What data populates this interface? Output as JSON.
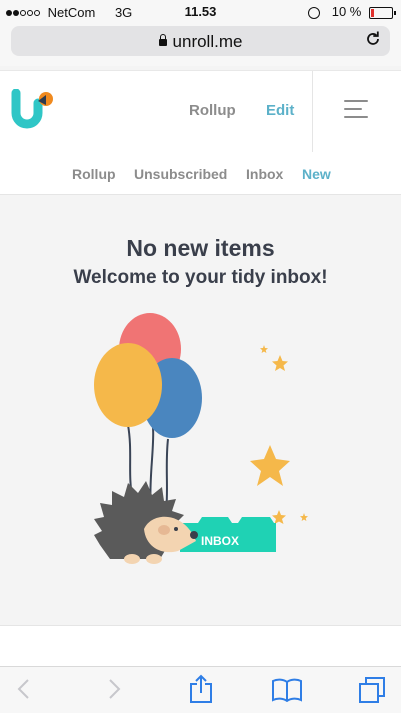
{
  "status_bar": {
    "carrier": "NetCom",
    "network": "3G",
    "time": "11.53",
    "battery": "10 %",
    "signal_dots_filled": 2,
    "signal_dots_total": 5,
    "battery_level": 0.1
  },
  "browser": {
    "url": "unroll.me",
    "reload_icon": "reload-icon",
    "lock_icon": "lock-icon"
  },
  "app_header": {
    "logo_icon": "unroll-me-logo",
    "nav": [
      {
        "label": "Rollup"
      },
      {
        "label": "Edit",
        "active": true
      }
    ],
    "menu_icon": "hamburger-menu-icon"
  },
  "sub_nav": {
    "tabs": [
      {
        "label": "Rollup"
      },
      {
        "label": "Unsubscribed"
      },
      {
        "label": "Inbox"
      },
      {
        "label": "New",
        "active": true
      }
    ]
  },
  "empty_state": {
    "title": "No new items",
    "subtitle": "Welcome to your tidy inbox!",
    "illustration_label": "INBOX"
  },
  "toolbar": {
    "buttons": [
      {
        "icon": "back-icon"
      },
      {
        "icon": "forward-icon"
      },
      {
        "icon": "share-icon"
      },
      {
        "icon": "bookmarks-icon"
      },
      {
        "icon": "tabs-icon"
      }
    ]
  },
  "colors": {
    "accent": "#5cb1c9",
    "teal_banner": "#1fd2b4",
    "balloon_red": "#f07474",
    "balloon_yellow": "#f5b84a",
    "balloon_blue": "#4a86bf",
    "star_yellow": "#f5b84a"
  }
}
